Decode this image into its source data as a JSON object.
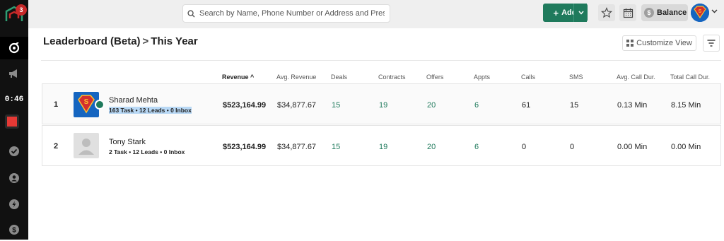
{
  "sidebar": {
    "logo_badge": "3",
    "timer": "0:46"
  },
  "topbar": {
    "search_placeholder": "Search by Name, Phone Number or Address and Press Ent",
    "add_label": "Add",
    "balance_label": "Balance"
  },
  "page": {
    "title_main": "Leaderboard (Beta)",
    "title_sep": ">",
    "title_sub": "This Year",
    "customize_label": "Customize View"
  },
  "table": {
    "columns": [
      {
        "label": "Revenue",
        "sorted": "asc"
      },
      {
        "label": "Avg. Revenue"
      },
      {
        "label": "Deals"
      },
      {
        "label": "Contracts"
      },
      {
        "label": "Offers"
      },
      {
        "label": "Appts"
      },
      {
        "label": "Calls"
      },
      {
        "label": "SMS"
      },
      {
        "label": "Avg. Call Dur."
      },
      {
        "label": "Total Call Dur."
      }
    ],
    "sort_arrow": "^",
    "rows": [
      {
        "rank": "1",
        "name": "Sharad Mehta",
        "summary": "163 Task • 12 Leads • 0 Inbox",
        "revenue": "$523,164.99",
        "avg_revenue": "$34,877.67",
        "deals": "15",
        "contracts": "19",
        "offers": "20",
        "appts": "6",
        "calls": "61",
        "sms": "15",
        "avg_call": "0.13 Min",
        "total_call": "8.15 Min"
      },
      {
        "rank": "2",
        "name": "Tony Stark",
        "summary": "2 Task • 12 Leads • 0 Inbox",
        "revenue": "$523,164.99",
        "avg_revenue": "$34,877.67",
        "deals": "15",
        "contracts": "19",
        "offers": "20",
        "appts": "6",
        "calls": "0",
        "sms": "0",
        "avg_call": "0.00 Min",
        "total_call": "0.00 Min"
      }
    ]
  },
  "colors": {
    "accent": "#1f7a5c",
    "sidebar_bg": "#111111",
    "topbar_bg": "#efefef",
    "record": "#e53935"
  }
}
